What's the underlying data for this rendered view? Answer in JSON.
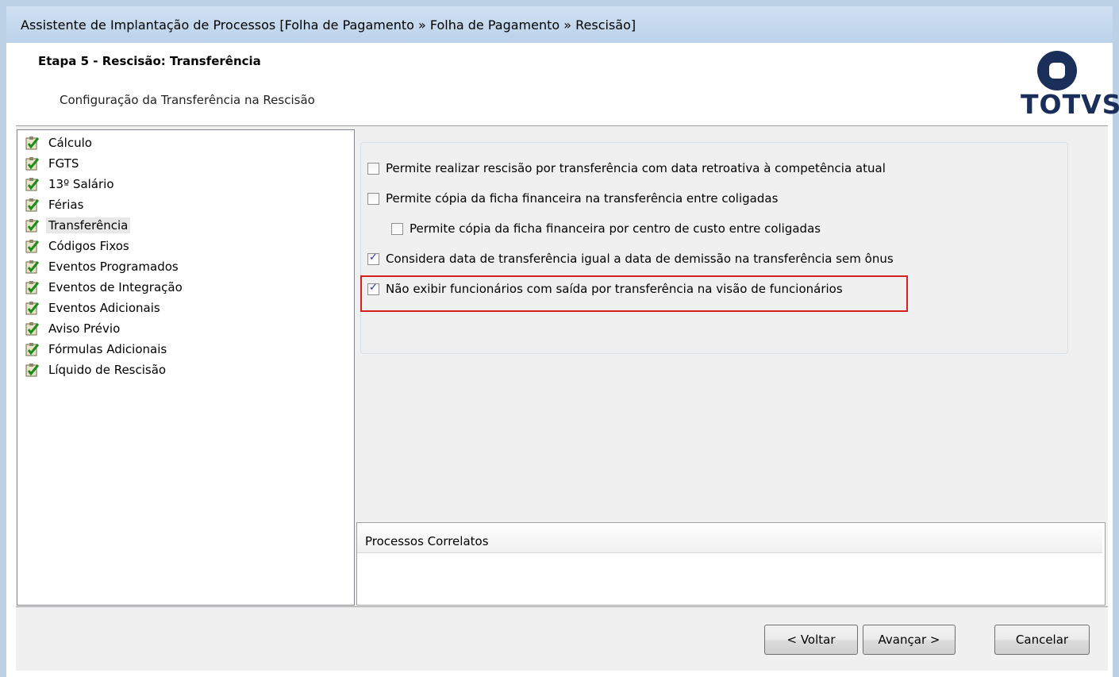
{
  "window": {
    "title": "Assistente de Implantação de Processos [Folha de Pagamento » Folha de Pagamento » Rescisão]"
  },
  "header": {
    "step_title": "Etapa 5 - Rescisão: Transferência",
    "subtitle": "Configuração da Transferência na Rescisão",
    "logo_text": "TOTVS"
  },
  "tree": {
    "items": [
      {
        "label": "Cálculo",
        "icon": "checked-task-icon"
      },
      {
        "label": "FGTS",
        "icon": "checked-task-icon"
      },
      {
        "label": "13º Salário",
        "icon": "checked-task-icon"
      },
      {
        "label": "Férias",
        "icon": "checked-task-icon"
      },
      {
        "label": "Transferência",
        "icon": "checked-task-icon",
        "selected": true
      },
      {
        "label": "Códigos Fixos",
        "icon": "checked-task-icon"
      },
      {
        "label": "Eventos Programados",
        "icon": "checked-task-icon"
      },
      {
        "label": "Eventos de Integração",
        "icon": "checked-task-icon"
      },
      {
        "label": "Eventos Adicionais",
        "icon": "checked-task-icon"
      },
      {
        "label": "Aviso Prévio",
        "icon": "checked-task-icon"
      },
      {
        "label": "Fórmulas Adicionais",
        "icon": "checked-task-icon"
      },
      {
        "label": "Líquido de Rescisão",
        "icon": "checked-task-icon"
      }
    ]
  },
  "options": [
    {
      "label": "Permite realizar rescisão por transferência com data retroativa à competência atual",
      "checked": false
    },
    {
      "label": "Permite cópia da ficha financeira na transferência entre coligadas",
      "checked": false
    },
    {
      "label": "Permite cópia da ficha financeira por centro de custo entre coligadas",
      "checked": false
    },
    {
      "label": "Considera data de transferência igual a data de demissão na transferência sem ônus",
      "checked": true
    },
    {
      "label": "Não exibir funcionários com saída por transferência na visão de funcionários",
      "checked": true
    }
  ],
  "correlatos": {
    "title": "Processos Correlatos"
  },
  "footer": {
    "back_label": "< Voltar",
    "next_label": "Avançar >",
    "cancel_label": "Cancelar"
  },
  "colors": {
    "highlight": "#d62020",
    "logo": "#1a2e5a",
    "check": "#21349b"
  }
}
